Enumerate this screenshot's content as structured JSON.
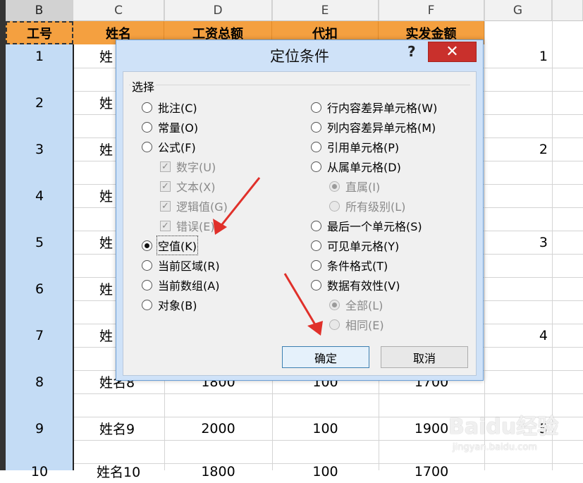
{
  "spreadsheet": {
    "column_headers": [
      "B",
      "C",
      "D",
      "E",
      "F",
      "G"
    ],
    "table_headers": [
      "工号",
      "姓名",
      "工资总额",
      "代扣",
      "实发金额"
    ],
    "row_ids": [
      "1",
      "2",
      "3",
      "4",
      "5",
      "6",
      "7",
      "8",
      "9",
      "10"
    ],
    "visible_names": [
      "姓",
      "姓",
      "姓",
      "姓",
      "姓",
      "姓",
      "姓",
      "姓名8",
      "姓名9",
      "姓名10"
    ],
    "row8": {
      "salary": "1800",
      "deduct": "100",
      "net": "1700"
    },
    "row9": {
      "name": "姓名9",
      "salary": "2000",
      "deduct": "100",
      "net": "1900"
    },
    "row10": {
      "salary": "1800",
      "deduct": "100",
      "net": "1700"
    },
    "column_g": [
      "1",
      "2",
      "3",
      "4",
      "5"
    ]
  },
  "dialog": {
    "title": "定位条件",
    "help": "?",
    "close": "✕",
    "group_label": "选择",
    "left_options": [
      {
        "label": "批注(C)",
        "state": "off",
        "enabled": true
      },
      {
        "label": "常量(O)",
        "state": "off",
        "enabled": true
      },
      {
        "label": "公式(F)",
        "state": "off",
        "enabled": true
      },
      {
        "label": "数字(U)",
        "state": "checked",
        "enabled": false,
        "type": "checkbox"
      },
      {
        "label": "文本(X)",
        "state": "checked",
        "enabled": false,
        "type": "checkbox"
      },
      {
        "label": "逻辑值(G)",
        "state": "checked",
        "enabled": false,
        "type": "checkbox"
      },
      {
        "label": "错误(E)",
        "state": "checked",
        "enabled": false,
        "type": "checkbox"
      },
      {
        "label": "空值(K)",
        "state": "on",
        "enabled": true
      },
      {
        "label": "当前区域(R)",
        "state": "off",
        "enabled": true
      },
      {
        "label": "当前数组(A)",
        "state": "off",
        "enabled": true
      },
      {
        "label": "对象(B)",
        "state": "off",
        "enabled": true
      }
    ],
    "right_options": [
      {
        "label": "行内容差异单元格(W)",
        "state": "off",
        "enabled": true
      },
      {
        "label": "列内容差异单元格(M)",
        "state": "off",
        "enabled": true
      },
      {
        "label": "引用单元格(P)",
        "state": "off",
        "enabled": true
      },
      {
        "label": "从属单元格(D)",
        "state": "off",
        "enabled": true
      },
      {
        "label": "直属(I)",
        "state": "on",
        "enabled": false
      },
      {
        "label": "所有级别(L)",
        "state": "off",
        "enabled": false
      },
      {
        "label": "最后一个单元格(S)",
        "state": "off",
        "enabled": true
      },
      {
        "label": "可见单元格(Y)",
        "state": "off",
        "enabled": true
      },
      {
        "label": "条件格式(T)",
        "state": "off",
        "enabled": true
      },
      {
        "label": "数据有效性(V)",
        "state": "off",
        "enabled": true
      },
      {
        "label": "全部(L)",
        "state": "on",
        "enabled": false
      },
      {
        "label": "相同(E)",
        "state": "off",
        "enabled": false
      }
    ],
    "ok_label": "确定",
    "cancel_label": "取消"
  },
  "annotations": {
    "arrow_color": "#e0302a"
  },
  "watermark": {
    "main": "Baidu经验",
    "sub": "jingyan.baidu.com"
  }
}
